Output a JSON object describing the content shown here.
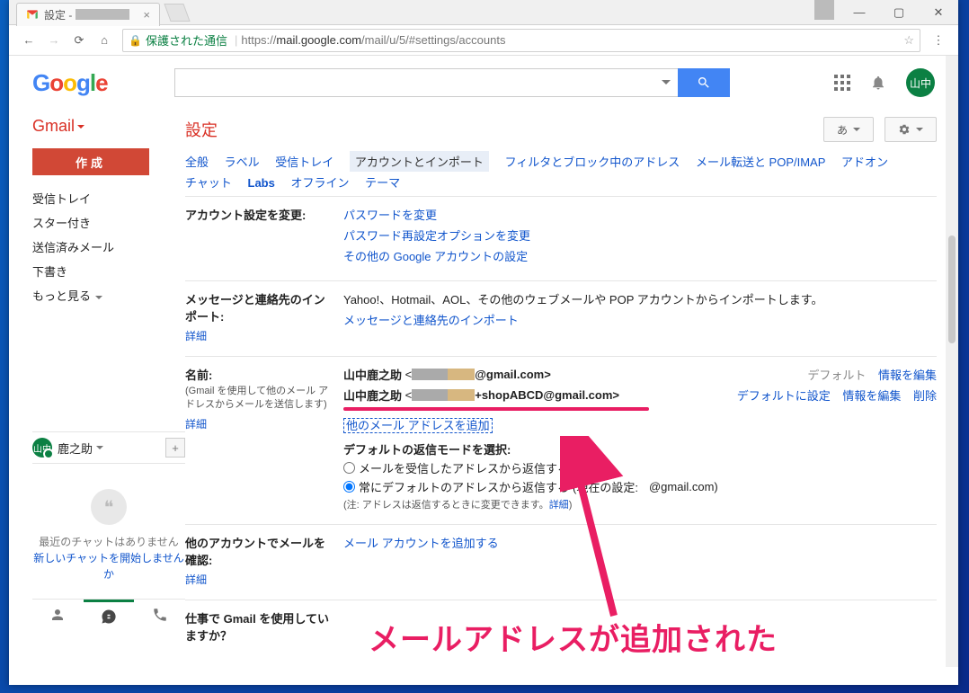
{
  "window": {
    "tab_title_prefix": "設定 - ",
    "secure_label": "保護された通信",
    "url_prefix": "https://",
    "url_host": "mail.google.com",
    "url_path": "/mail/u/5/#settings/accounts"
  },
  "gbar": {
    "avatar": "山中"
  },
  "brand": "Gmail",
  "compose": "作成",
  "leftnav": {
    "inbox": "受信トレイ",
    "starred": "スター付き",
    "sent": "送信済みメール",
    "drafts": "下書き",
    "more": "もっと見る"
  },
  "header": {
    "title": "設定",
    "lang_btn": "あ"
  },
  "tabs": {
    "general": "全般",
    "labels": "ラベル",
    "inbox": "受信トレイ",
    "accounts": "アカウントとインポート",
    "filters": "フィルタとブロック中のアドレス",
    "forwarding": "メール転送と POP/IMAP",
    "addons": "アドオン",
    "chat": "チャット",
    "labs": "Labs",
    "offline": "オフライン",
    "themes": "テーマ"
  },
  "sec_account": {
    "title": "アカウント設定を変更:",
    "pw": "パスワードを変更",
    "pwopt": "パスワード再設定オプションを変更",
    "other": "その他の Google アカウントの設定"
  },
  "sec_import": {
    "title": "メッセージと連絡先のインポート:",
    "desc": "Yahoo!、Hotmail、AOL、その他のウェブメールや POP アカウントからインポートします。",
    "link": "メッセージと連絡先のインポート",
    "detail": "詳細"
  },
  "sec_name": {
    "title": "名前:",
    "hint": "(Gmail を使用して他のメール アドレスからメールを送信します)",
    "detail": "詳細",
    "row1_name": "山中鹿之助",
    "row1_suffix": "@gmail.com>",
    "row1_default": "デフォルト",
    "row1_edit": "情報を編集",
    "row2_name": "山中鹿之助",
    "row2_mid": "+shopABCD@gmail.com>",
    "row2_setdefault": "デフォルトに設定",
    "row2_edit": "情報を編集",
    "row2_delete": "削除",
    "add": "他のメール アドレスを追加",
    "reply_title": "デフォルトの返信モードを選択:",
    "reply_opt1": "メールを受信したアドレスから返信する",
    "reply_opt2_a": "常にデフォルトのアドレスから返信する",
    "reply_opt2_b": " (現在の設定: ",
    "reply_opt2_c": "@gmail.com)",
    "note_a": "(注: アドレスは返信するときに変更できます。",
    "note_link": "詳細",
    "note_b": ")"
  },
  "sec_check": {
    "title": "他のアカウントでメールを確認:",
    "link": "メール アカウントを追加する",
    "detail": "詳細"
  },
  "sec_work": {
    "title": "仕事で Gmail を使用していますか？"
  },
  "hangouts": {
    "me": "鹿之助",
    "empty1": "最近のチャットはありません",
    "empty2": "新しいチャットを開始しませんか"
  },
  "annotation": "メールアドレスが追加された"
}
